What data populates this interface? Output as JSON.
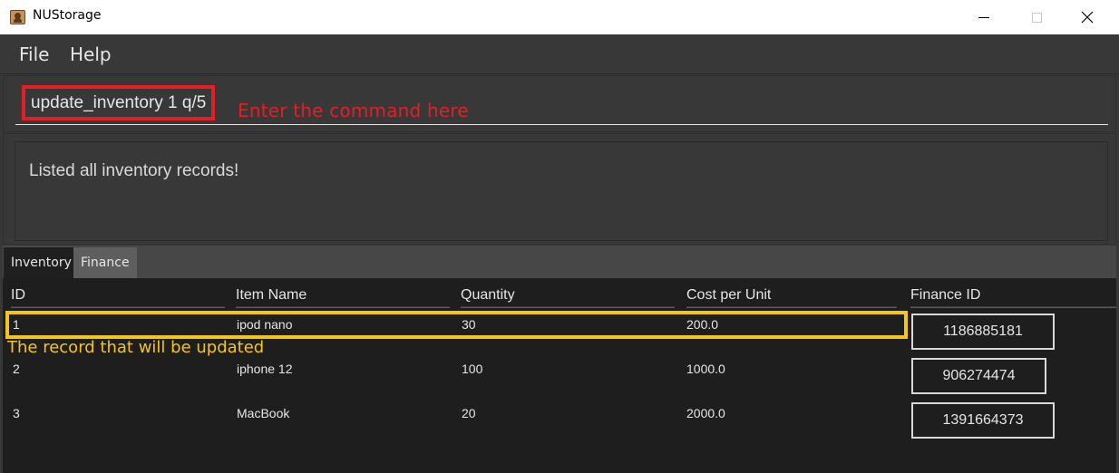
{
  "window": {
    "title": "NUStorage",
    "controls": {
      "minimize": "minimize",
      "maximize": "maximize",
      "close": "close"
    }
  },
  "menu": {
    "items": [
      {
        "label": "File"
      },
      {
        "label": "Help"
      }
    ]
  },
  "command": {
    "value": "update_inventory 1 q/5",
    "annotation": "Enter the command here"
  },
  "result": {
    "text": "Listed all inventory records!"
  },
  "tabs": [
    {
      "label": "Inventory",
      "active": true
    },
    {
      "label": "Finance",
      "active": false
    }
  ],
  "table": {
    "columns": [
      "ID",
      "Item Name",
      "Quantity",
      "Cost per Unit",
      "Finance ID"
    ],
    "rows": [
      {
        "id": "1",
        "name": "ipod nano",
        "quantity": "30",
        "cost": "200.0",
        "finance_id": "1186885181"
      },
      {
        "id": "2",
        "name": "iphone 12",
        "quantity": "100",
        "cost": "1000.0",
        "finance_id": "906274474"
      },
      {
        "id": "3",
        "name": "MacBook",
        "quantity": "20",
        "cost": "2000.0",
        "finance_id": "1391664373"
      }
    ],
    "highlight_annotation": "The record that will be updated"
  },
  "colors": {
    "command_annotation": "#e21f26",
    "record_annotation": "#f5c518"
  }
}
